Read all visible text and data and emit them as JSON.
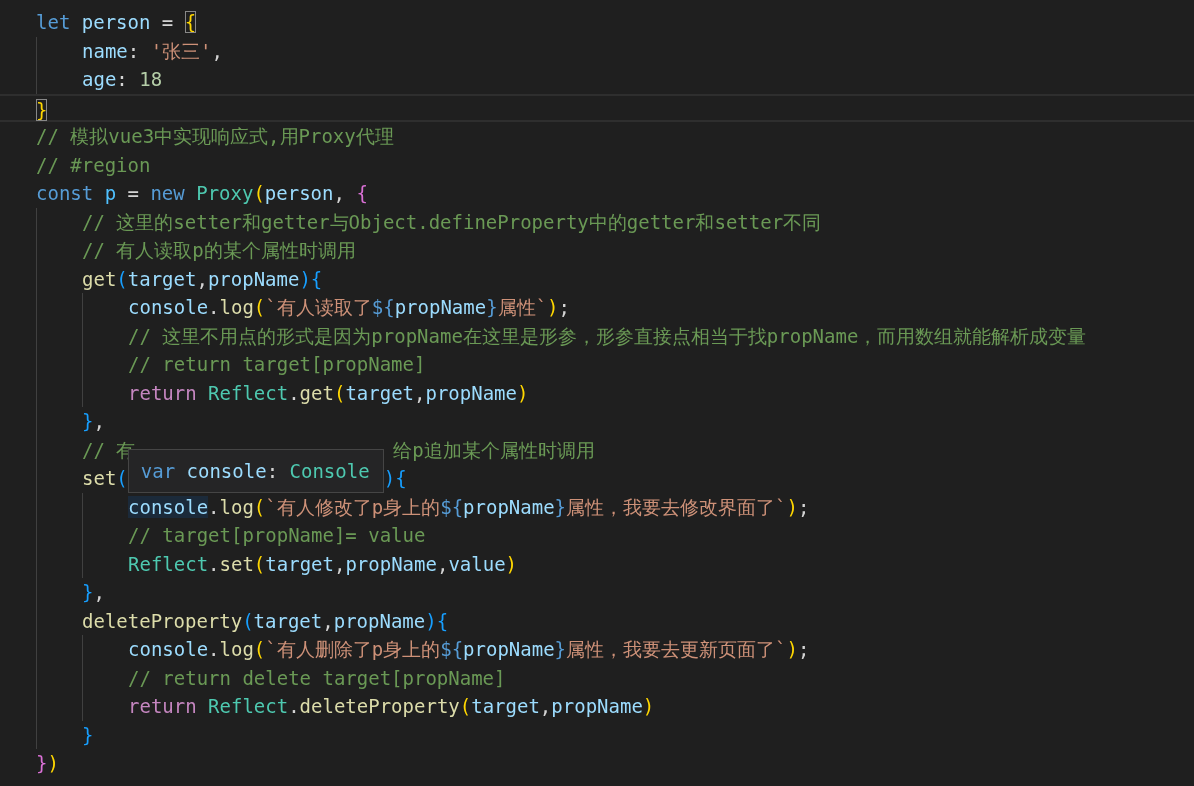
{
  "editor": {
    "lines": [
      {
        "tokens": [
          {
            "t": "let ",
            "kind": "keyword"
          },
          {
            "t": "person",
            "kind": "variable"
          },
          {
            "t": " = ",
            "kind": "punct"
          },
          {
            "t": "{",
            "kind": "brace1",
            "matched": true
          }
        ],
        "children": [
          {
            "tokens": [
              {
                "t": "name",
                "kind": "variable"
              },
              {
                "t": ": ",
                "kind": "punct"
              },
              {
                "t": "'张三'",
                "kind": "string"
              },
              {
                "t": ",",
                "kind": "punct"
              }
            ]
          },
          {
            "tokens": [
              {
                "t": "age",
                "kind": "variable"
              },
              {
                "t": ": ",
                "kind": "punct"
              },
              {
                "t": "18",
                "kind": "number"
              }
            ]
          }
        ]
      },
      {
        "current": true,
        "tokens": [
          {
            "t": "}",
            "kind": "brace1",
            "matched": true
          }
        ]
      },
      {
        "tokens": [
          {
            "t": "// 模拟vue3中实现响应式,用Proxy代理",
            "kind": "comment"
          }
        ]
      },
      {
        "tokens": [
          {
            "t": "// #region",
            "kind": "comment"
          }
        ]
      },
      {
        "tokens": [
          {
            "t": "const ",
            "kind": "keyword"
          },
          {
            "t": "p",
            "kind": "constant"
          },
          {
            "t": " = ",
            "kind": "punct"
          },
          {
            "t": "new ",
            "kind": "keyword"
          },
          {
            "t": "Proxy",
            "kind": "class"
          },
          {
            "t": "(",
            "kind": "brace1"
          },
          {
            "t": "person",
            "kind": "variable"
          },
          {
            "t": ", ",
            "kind": "punct"
          },
          {
            "t": "{",
            "kind": "brace2"
          }
        ],
        "children": [
          {
            "tokens": [
              {
                "t": "// 这里的setter和getter与Object.defineProperty中的getter和setter不同",
                "kind": "comment"
              }
            ]
          },
          {
            "tokens": [
              {
                "t": "// 有人读取p的某个属性时调用",
                "kind": "comment"
              }
            ]
          },
          {
            "tokens": [
              {
                "t": "get",
                "kind": "function"
              },
              {
                "t": "(",
                "kind": "brace3"
              },
              {
                "t": "target",
                "kind": "variable"
              },
              {
                "t": ",",
                "kind": "punct"
              },
              {
                "t": "propName",
                "kind": "variable"
              },
              {
                "t": ")",
                "kind": "brace3"
              },
              {
                "t": "{",
                "kind": "brace3"
              }
            ],
            "children": [
              {
                "tokens": [
                  {
                    "t": "console",
                    "kind": "variable"
                  },
                  {
                    "t": ".",
                    "kind": "punct"
                  },
                  {
                    "t": "log",
                    "kind": "function"
                  },
                  {
                    "t": "(",
                    "kind": "brace1"
                  },
                  {
                    "t": "`有人读取了",
                    "kind": "string"
                  },
                  {
                    "t": "${",
                    "kind": "keyword"
                  },
                  {
                    "t": "propName",
                    "kind": "variable"
                  },
                  {
                    "t": "}",
                    "kind": "keyword"
                  },
                  {
                    "t": "属性`",
                    "kind": "string"
                  },
                  {
                    "t": ")",
                    "kind": "brace1"
                  },
                  {
                    "t": ";",
                    "kind": "punct"
                  }
                ]
              },
              {
                "tokens": [
                  {
                    "t": "// 这里不用点的形式是因为propName在这里是形参，形参直接点相当于找propName，而用数组就能解析成变量",
                    "kind": "comment"
                  }
                ]
              },
              {
                "tokens": [
                  {
                    "t": "// return target[propName]",
                    "kind": "comment"
                  }
                ]
              },
              {
                "tokens": [
                  {
                    "t": "return ",
                    "kind": "control"
                  },
                  {
                    "t": "Reflect",
                    "kind": "class"
                  },
                  {
                    "t": ".",
                    "kind": "punct"
                  },
                  {
                    "t": "get",
                    "kind": "function"
                  },
                  {
                    "t": "(",
                    "kind": "brace1"
                  },
                  {
                    "t": "target",
                    "kind": "variable"
                  },
                  {
                    "t": ",",
                    "kind": "punct"
                  },
                  {
                    "t": "propName",
                    "kind": "variable"
                  },
                  {
                    "t": ")",
                    "kind": "brace1"
                  }
                ]
              }
            ]
          },
          {
            "tokens": [
              {
                "t": "}",
                "kind": "brace3"
              },
              {
                "t": ",",
                "kind": "punct"
              }
            ]
          },
          {
            "tokens": [
              {
                "t": "// 有",
                "kind": "comment"
              }
            ],
            "after": [
              {
                "t": "给p追加某个属性时调用",
                "kind": "comment"
              }
            ]
          },
          {
            "tokens": [
              {
                "t": "set",
                "kind": "function"
              },
              {
                "t": "(",
                "kind": "brace3"
              }
            ],
            "after": [
              {
                "t": ")",
                "kind": "brace3"
              },
              {
                "t": "{",
                "kind": "brace3"
              }
            ],
            "children": [
              {
                "tokens": [
                  {
                    "t": "console",
                    "kind": "variable",
                    "highlighted": true
                  },
                  {
                    "t": ".",
                    "kind": "punct"
                  },
                  {
                    "t": "log",
                    "kind": "function"
                  },
                  {
                    "t": "(",
                    "kind": "brace1"
                  },
                  {
                    "t": "`有人修改了p身上的",
                    "kind": "string"
                  },
                  {
                    "t": "${",
                    "kind": "keyword"
                  },
                  {
                    "t": "propName",
                    "kind": "variable"
                  },
                  {
                    "t": "}",
                    "kind": "keyword"
                  },
                  {
                    "t": "属性，我要去修改界面了`",
                    "kind": "string"
                  },
                  {
                    "t": ")",
                    "kind": "brace1"
                  },
                  {
                    "t": ";",
                    "kind": "punct"
                  }
                ]
              },
              {
                "tokens": [
                  {
                    "t": "// target[propName]= value",
                    "kind": "comment"
                  }
                ]
              },
              {
                "tokens": [
                  {
                    "t": "Reflect",
                    "kind": "class"
                  },
                  {
                    "t": ".",
                    "kind": "punct"
                  },
                  {
                    "t": "set",
                    "kind": "function"
                  },
                  {
                    "t": "(",
                    "kind": "brace1"
                  },
                  {
                    "t": "target",
                    "kind": "variable"
                  },
                  {
                    "t": ",",
                    "kind": "punct"
                  },
                  {
                    "t": "propName",
                    "kind": "variable"
                  },
                  {
                    "t": ",",
                    "kind": "punct"
                  },
                  {
                    "t": "value",
                    "kind": "variable"
                  },
                  {
                    "t": ")",
                    "kind": "brace1"
                  }
                ]
              }
            ]
          },
          {
            "tokens": [
              {
                "t": "}",
                "kind": "brace3"
              },
              {
                "t": ",",
                "kind": "punct"
              }
            ]
          },
          {
            "tokens": [
              {
                "t": "deleteProperty",
                "kind": "function"
              },
              {
                "t": "(",
                "kind": "brace3"
              },
              {
                "t": "target",
                "kind": "variable"
              },
              {
                "t": ",",
                "kind": "punct"
              },
              {
                "t": "propName",
                "kind": "variable"
              },
              {
                "t": ")",
                "kind": "brace3"
              },
              {
                "t": "{",
                "kind": "brace3"
              }
            ],
            "children": [
              {
                "tokens": [
                  {
                    "t": "console",
                    "kind": "variable"
                  },
                  {
                    "t": ".",
                    "kind": "punct"
                  },
                  {
                    "t": "log",
                    "kind": "function"
                  },
                  {
                    "t": "(",
                    "kind": "brace1"
                  },
                  {
                    "t": "`有人删除了p身上的",
                    "kind": "string"
                  },
                  {
                    "t": "${",
                    "kind": "keyword"
                  },
                  {
                    "t": "propName",
                    "kind": "variable"
                  },
                  {
                    "t": "}",
                    "kind": "keyword"
                  },
                  {
                    "t": "属性，我要去更新页面了`",
                    "kind": "string"
                  },
                  {
                    "t": ")",
                    "kind": "brace1"
                  },
                  {
                    "t": ";",
                    "kind": "punct"
                  }
                ]
              },
              {
                "tokens": [
                  {
                    "t": "// return delete target[propName]",
                    "kind": "comment"
                  }
                ]
              },
              {
                "tokens": [
                  {
                    "t": "return ",
                    "kind": "control"
                  },
                  {
                    "t": "Reflect",
                    "kind": "class"
                  },
                  {
                    "t": ".",
                    "kind": "punct"
                  },
                  {
                    "t": "deleteProperty",
                    "kind": "function"
                  },
                  {
                    "t": "(",
                    "kind": "brace1"
                  },
                  {
                    "t": "target",
                    "kind": "variable"
                  },
                  {
                    "t": ",",
                    "kind": "punct"
                  },
                  {
                    "t": "propName",
                    "kind": "variable"
                  },
                  {
                    "t": ")",
                    "kind": "brace1"
                  }
                ]
              }
            ]
          },
          {
            "tokens": [
              {
                "t": "}",
                "kind": "brace3"
              }
            ]
          }
        ]
      },
      {
        "tokens": [
          {
            "t": "}",
            "kind": "brace2"
          },
          {
            "t": ")",
            "kind": "brace1"
          }
        ]
      }
    ]
  },
  "tooltip": {
    "tokens": [
      {
        "t": "var ",
        "kind": "keyword"
      },
      {
        "t": "console",
        "kind": "variable"
      },
      {
        "t": ": ",
        "kind": "punct"
      },
      {
        "t": "Console",
        "kind": "class"
      }
    ]
  }
}
